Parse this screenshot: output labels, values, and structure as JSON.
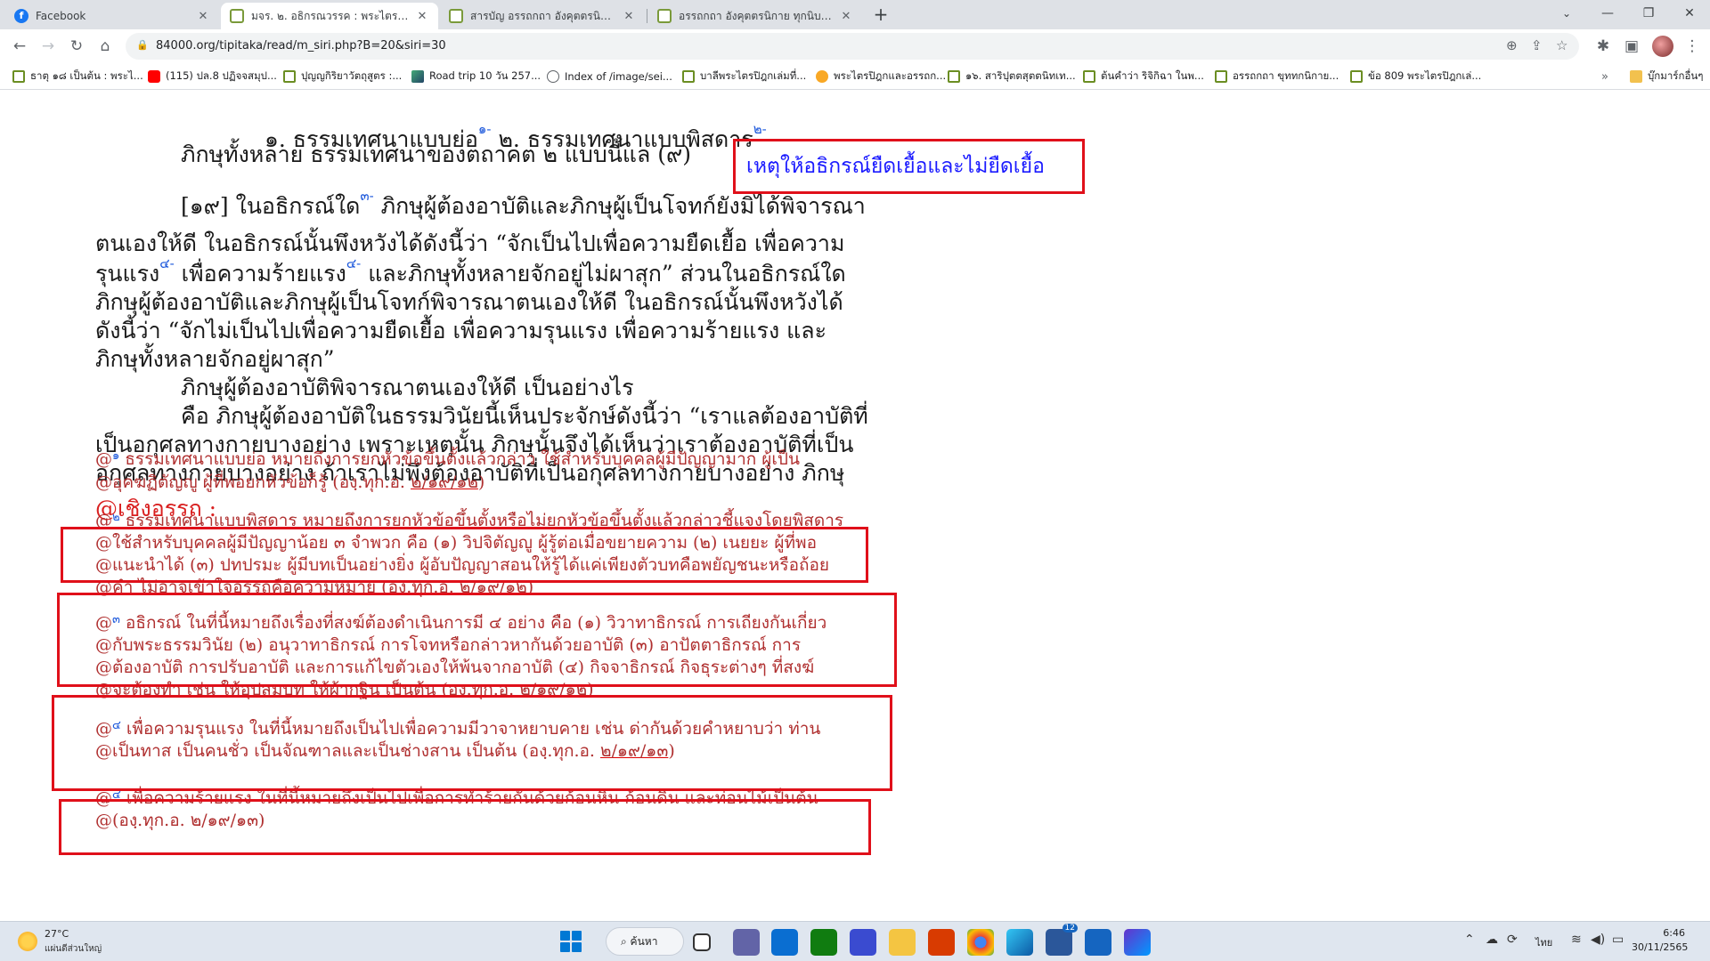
{
  "tabs": [
    {
      "title": "Facebook",
      "active": false
    },
    {
      "title": "มจร. ๒. อธิกรณวรรค : พระไตรปิฎกเล่ม",
      "active": true
    },
    {
      "title": "สารบัญ อรรถกถา อังคุตตรนิกาย ทุกนิบ",
      "active": false
    },
    {
      "title": "อรรถกถา อังคุตตรนิกาย ทุกนิบาต ปฐ",
      "active": false
    }
  ],
  "toolbar": {
    "url": "84000.org/tipitaka/read/m_siri.php?B=20&siri=30"
  },
  "bookmarks": [
    {
      "label": "ธาตุ ๑๘ เป็นต้น : พระไ...",
      "icon": "leaf-icon"
    },
    {
      "label": "(115) ปล.8 ปฏิจจสมุป...",
      "icon": "youtube-icon"
    },
    {
      "label": "ปุญญกิริยาวัตถุสูตร :...",
      "icon": "leaf-icon"
    },
    {
      "label": "Road trip 10 วัน 257...",
      "icon": "image-icon"
    },
    {
      "label": "Index of /image/sei...",
      "icon": "globe-icon"
    },
    {
      "label": "บาลีพระไตรปิฎกเล่มที่...",
      "icon": "leaf-icon"
    },
    {
      "label": "พระไตรปิฎกและอรรถก...",
      "icon": "sun-icon"
    },
    {
      "label": "๑๖. สาริปุตตสุตตนิทเท...",
      "icon": "leaf-icon"
    },
    {
      "label": "ต้นคำว่า ริจิกิฉา ในพ...",
      "icon": "leaf-icon"
    },
    {
      "label": "อรรถกถา ขุททกนิกาย...",
      "icon": "leaf-icon"
    },
    {
      "label": "ข้อ 809 พระไตรปิฎกเล่...",
      "icon": "leaf-icon"
    }
  ],
  "bookmarks_other": "บุ๊กมาร์กอื่นๆ",
  "page": {
    "lines": [
      {
        "segs": [
          {
            "t": "๑. ธรรมเทศนาแบบย่อ"
          },
          {
            "t": "๑-",
            "sup": true
          },
          {
            "t": " ๒. ธรรมเทศนาแบบพิสดาร"
          },
          {
            "t": "๒-",
            "sup": true
          }
        ]
      },
      {
        "segs": [
          {
            "t": "ภิกษุทั้งหลาย ธรรมเทศนาของตถาคต ๒ แบบนี้แล (๙)"
          }
        ]
      },
      {
        "segs": [
          {
            "t": "[๑๙] ในอธิกรณ์ใด"
          },
          {
            "t": "๓-",
            "sup": true
          },
          {
            "t": " ภิกษุผู้ต้องอาบัติและภิกษุผู้เป็นโจทก์ยังมิได้พิจารณา"
          }
        ]
      },
      {
        "segs": [
          {
            "t": "ตนเองให้ดี ในอธิกรณ์นั้นพึงหวังได้ดังนี้ว่า “จักเป็นไปเพื่อความยืดเยื้อ เพื่อความ"
          }
        ]
      },
      {
        "segs": [
          {
            "t": "รุนแรง"
          },
          {
            "t": "๔-",
            "sup": true
          },
          {
            "t": " เพื่อความร้ายแรง"
          },
          {
            "t": "๔-",
            "sup": true
          },
          {
            "t": " และภิกษุทั้งหลายจักอยู่ไม่ผาสุก” ส่วนในอธิกรณ์ใด"
          }
        ]
      },
      {
        "segs": [
          {
            "t": "ภิกษุผู้ต้องอาบัติและภิกษุผู้เป็นโจทก์พิจารณาตนเองให้ดี ในอธิกรณ์นั้นพึงหวังได้"
          }
        ]
      },
      {
        "segs": [
          {
            "t": "ดังนี้ว่า “จักไม่เป็นไปเพื่อความยืดเยื้อ เพื่อความรุนแรง เพื่อความร้ายแรง และ"
          }
        ]
      },
      {
        "segs": [
          {
            "t": "ภิกษุทั้งหลายจักอยู่ผาสุก”"
          }
        ]
      },
      {
        "segs": [
          {
            "t": "ภิกษุผู้ต้องอาบัติพิจารณาตนเองให้ดี เป็นอย่างไร"
          }
        ]
      },
      {
        "segs": [
          {
            "t": "คือ ภิกษุผู้ต้องอาบัติในธรรมวินัยนี้เห็นประจักษ์ดังนี้ว่า “เราแลต้องอาบัติที่"
          }
        ]
      },
      {
        "segs": [
          {
            "t": "เป็นอกุศลทางกายบางอย่าง เพราะเหตุนั้น ภิกษุนั้นจึงได้เห็นว่าเราต้องอาบัติที่เป็น"
          }
        ]
      },
      {
        "segs": [
          {
            "t": "อกุศลทางกายบางอย่าง ถ้าเราไม่พึงต้องอาบัติที่เป็นอกุศลทางกายบางอย่าง ภิกษุ"
          }
        ]
      }
    ],
    "annotation": "เหตุให้อธิกรณ์ยืดเยื้อและไม่ยืดเยื้อ",
    "commentary_heading": "@เชิงอรรถ :",
    "notes": [
      {
        "segs": [
          {
            "t": "@"
          },
          {
            "t": "๑",
            "n": true
          },
          {
            "t": " ธรรมเทศนาแบบย่อ หมายถึงการยกหัวข้อขึ้นตั้งแล้วกล่าว ใช้สำหรับบุคคลผู้มีปัญญามาก ผู้เป็น"
          }
        ]
      },
      {
        "segs": [
          {
            "t": "@อุคฆฏิตัญญู ผู้ที่พอยกหัวข้อก็รู้ (องฺ.ทุก.อ. "
          },
          {
            "t": "๒/๑๙/๑๒",
            "ref": true
          },
          {
            "t": ")"
          }
        ]
      },
      {
        "segs": [
          {
            "t": "@"
          },
          {
            "t": "๒",
            "n": true
          },
          {
            "t": " ธรรมเทศนาแบบพิสดาร หมายถึงการยกหัวข้อขึ้นตั้งหรือไม่ยกหัวข้อขึ้นตั้งแล้วกล่าวชี้แจงโดยพิสดาร"
          }
        ]
      },
      {
        "segs": [
          {
            "t": "@ใช้สำหรับบุคคลผู้มีปัญญาน้อย ๓ จำพวก คือ (๑) วิปจิตัญญู ผู้รู้ต่อเมื่อขยายความ (๒) เนยยะ ผู้ที่พอ"
          }
        ]
      },
      {
        "segs": [
          {
            "t": "@แนะนำได้ (๓) ปทปรมะ ผู้มีบทเป็นอย่างยิ่ง ผู้อับปัญญาสอนให้รู้ได้แค่เพียงตัวบทคือพยัญชนะหรือถ้อย"
          }
        ]
      },
      {
        "segs": [
          {
            "t": "@คำ ไม่อาจเข้าใจอรรถคือความหมาย (องฺ.ทุก.อ. ๒/๑๙/๑๒)"
          }
        ]
      },
      {
        "segs": [
          {
            "t": "@"
          },
          {
            "t": "๓",
            "n": true
          },
          {
            "t": " อธิกรณ์ ในที่นี้หมายถึงเรื่องที่สงฆ์ต้องดำเนินการมี ๔ อย่าง คือ (๑) วิวาทาธิกรณ์ การเถียงกันเกี่ยว"
          }
        ]
      },
      {
        "segs": [
          {
            "t": "@กับพระธรรมวินัย (๒) อนุวาทาธิกรณ์ การโจทหรือกล่าวหากันด้วยอาบัติ (๓) อาปัตตาธิกรณ์ การ"
          }
        ]
      },
      {
        "segs": [
          {
            "t": "@ต้องอาบัติ การปรับอาบัติ และการแก้ไขตัวเองให้พ้นจากอาบัติ (๔) กิจจาธิกรณ์ กิจธุระต่างๆ ที่สงฆ์"
          }
        ]
      },
      {
        "segs": [
          {
            "t": "@จะต้องทำ เช่น ให้อุปสมบท ให้ผ้ากฐิน เป็นต้น (องฺ.ทุก.อ. "
          },
          {
            "t": "๒/๑๙/๑๒",
            "ref": true
          },
          {
            "t": ")"
          }
        ]
      },
      {
        "segs": [
          {
            "t": "@"
          },
          {
            "t": "๔",
            "n": true
          },
          {
            "t": " เพื่อความรุนแรง ในที่นี้หมายถึงเป็นไปเพื่อความมีวาจาหยาบคาย เช่น ด่ากันด้วยคำหยาบว่า ท่าน"
          }
        ]
      },
      {
        "segs": [
          {
            "t": "@เป็นทาส เป็นคนชั่ว เป็นจัณฑาลและเป็นช่างสาน เป็นต้น (องฺ.ทุก.อ. "
          },
          {
            "t": "๒/๑๙/๑๓",
            "ref": true
          },
          {
            "t": ")"
          }
        ]
      },
      {
        "segs": [
          {
            "t": "@"
          },
          {
            "t": "๔",
            "n": true
          },
          {
            "t": " เพื่อความร้ายแรง ในที่นี้หมายถึงเป็นไปเพื่อการทำร้ายกันด้วยก้อนหิน ก้อนดิน และท่อนไม้เป็นต้น"
          }
        ]
      },
      {
        "segs": [
          {
            "t": "@(องฺ.ทุก.อ. ๒/๑๙/๑๓)"
          }
        ]
      }
    ]
  },
  "taskbar": {
    "weather_temp": "27°C",
    "weather_desc": "แผ่นดีส่วนใหญ่",
    "search_label": "ค้นหา",
    "lang": "ไทย",
    "time": "6:46",
    "date": "30/11/2565",
    "badge": "12"
  },
  "colors": {
    "annotation_box": "#e0101a",
    "annotation_text": "#1a1aff",
    "note_text": "#b03030",
    "footnote_marker": "#1a56db"
  }
}
